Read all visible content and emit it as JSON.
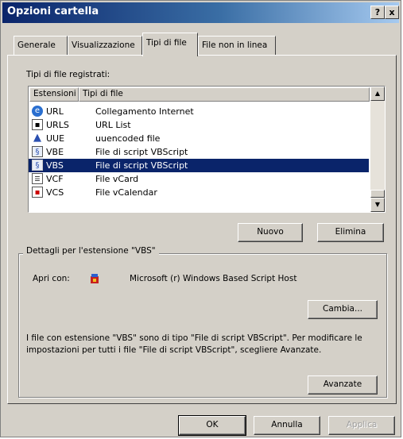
{
  "window": {
    "title": "Opzioni cartella",
    "help_glyph": "?",
    "close_glyph": "x"
  },
  "tabs": [
    {
      "label": "Generale"
    },
    {
      "label": "Visualizzazione"
    },
    {
      "label": "Tipi di file"
    },
    {
      "label": "File non in linea"
    }
  ],
  "registered_label": "Tipi di file registrati:",
  "list": {
    "headers": [
      "Estensioni",
      "Tipi di file"
    ],
    "rows": [
      {
        "ext": "URL",
        "type": "Collegamento Internet"
      },
      {
        "ext": "URLS",
        "type": "URL List"
      },
      {
        "ext": "UUE",
        "type": "uuencoded file"
      },
      {
        "ext": "VBE",
        "type": "File di script VBScript"
      },
      {
        "ext": "VBS",
        "type": "File di script VBScript"
      },
      {
        "ext": "VCF",
        "type": "File vCard"
      },
      {
        "ext": "VCS",
        "type": "File vCalendar"
      }
    ],
    "selected_index": 4
  },
  "buttons": {
    "nuovo": "Nuovo",
    "elimina": "Elimina",
    "cambia": "Cambia...",
    "avanzate": "Avanzate",
    "ok": "OK",
    "annulla": "Annulla",
    "applica": "Applica"
  },
  "details": {
    "title": "Dettagli per l'estensione \"VBS\"",
    "open_with_label": "Apri con:",
    "open_with_app": "Microsoft (r) Windows Based Script Host",
    "description": "I file con estensione \"VBS\" sono di tipo \"File di script VBScript\". Per modificare le impostazioni per tutti i file \"File di script VBScript\", scegliere Avanzate."
  },
  "colors": {
    "title_start": "#0a246a",
    "title_end": "#a6caf0",
    "selection": "#0a246a",
    "face": "#d4d0c8"
  }
}
